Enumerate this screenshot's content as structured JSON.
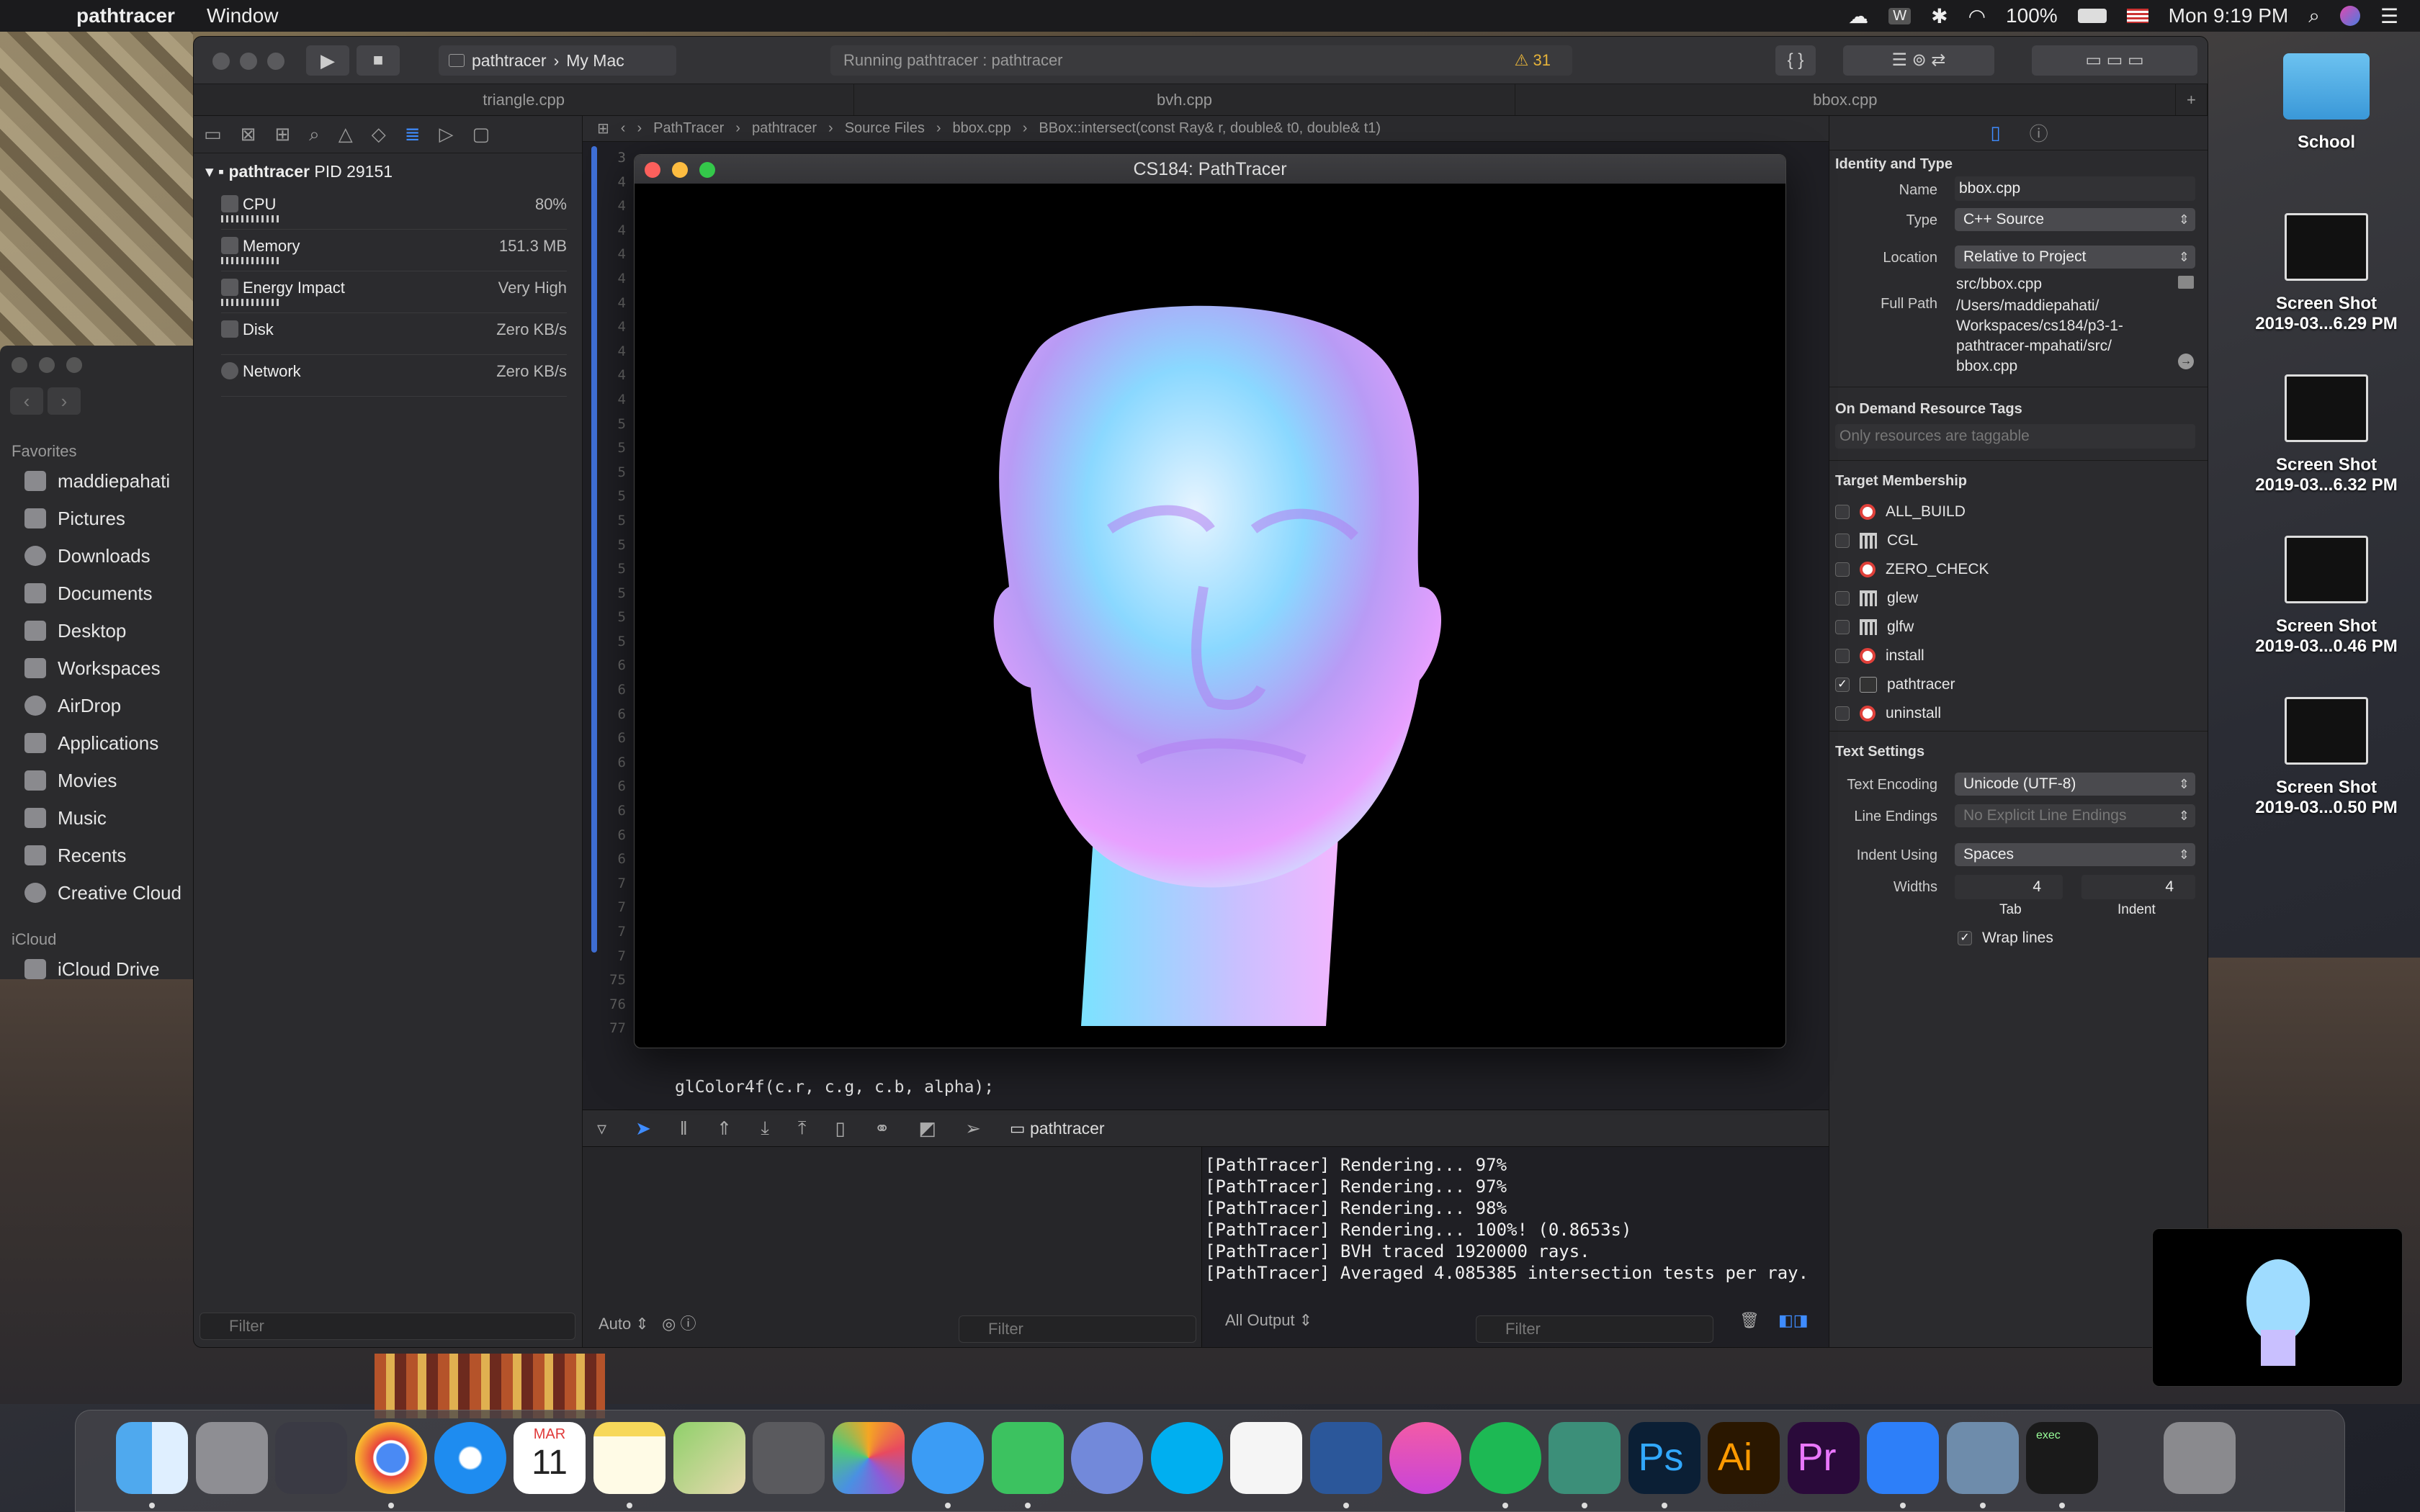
{
  "menubar": {
    "app": "pathtracer",
    "menu": "Window",
    "battery": "100%",
    "clock": "Mon 9:19 PM"
  },
  "finder": {
    "favorites_header": "Favorites",
    "items": [
      "maddiepahati",
      "Pictures",
      "Downloads",
      "Documents",
      "Desktop",
      "Workspaces",
      "AirDrop",
      "Applications",
      "Movies",
      "Music",
      "Recents",
      "Creative Cloud"
    ],
    "icloud_header": "iCloud",
    "icloud_item": "iCloud Drive"
  },
  "xcode": {
    "scheme": "pathtracer",
    "destination": "My Mac",
    "activity": "Running pathtracer : pathtracer",
    "warnings": "31",
    "tabs": [
      "triangle.cpp",
      "bvh.cpp",
      "bbox.cpp"
    ],
    "process": {
      "name": "pathtracer",
      "pid": "PID 29151"
    },
    "gauges": [
      {
        "label": "CPU",
        "value": "80%"
      },
      {
        "label": "Memory",
        "value": "151.3 MB"
      },
      {
        "label": "Energy Impact",
        "value": "Very High"
      },
      {
        "label": "Disk",
        "value": "Zero KB/s"
      },
      {
        "label": "Network",
        "value": "Zero KB/s"
      }
    ],
    "nav_filter": "Filter",
    "jumpbar": [
      "PathTracer",
      "pathtracer",
      "Source Files",
      "bbox.cpp",
      "BBox::intersect(const Ray& r, double& t0, double& t1)"
    ],
    "line_numbers": [
      "3",
      "4",
      "4",
      "4",
      "4",
      "4",
      "4",
      "4",
      "4",
      "4",
      "4",
      "5",
      "5",
      "5",
      "5",
      "5",
      "5",
      "5",
      "5",
      "5",
      "5",
      "6",
      "6",
      "6",
      "6",
      "6",
      "6",
      "6",
      "6",
      "6",
      "7",
      "7",
      "7",
      "7",
      "75",
      "76",
      "77"
    ],
    "code_line_76": "glColor4f(c.r, c.g, c.b, alpha);",
    "debug_target": "pathtracer",
    "console": [
      "[PathTracer] Rendering... 97%",
      "[PathTracer] Rendering... 97%",
      "[PathTracer] Rendering... 98%",
      "[PathTracer] Rendering... 100%! (0.8653s)",
      "[PathTracer] BVH traced 1920000 rays.",
      "[PathTracer] Averaged 4.085385 intersection tests per ray."
    ],
    "vars_mode": "Auto",
    "filter": "Filter",
    "output_mode": "All Output"
  },
  "inspector": {
    "identity_title": "Identity and Type",
    "name_label": "Name",
    "name_value": "bbox.cpp",
    "type_label": "Type",
    "type_value": "C++ Source",
    "location_label": "Location",
    "location_value": "Relative to Project",
    "relative_path": "src/bbox.cpp",
    "fullpath_label": "Full Path",
    "fullpath_lines": [
      "/Users/maddiepahati/",
      "Workspaces/cs184/p3-1-",
      "pathtracer-mpahati/src/",
      "bbox.cpp"
    ],
    "odr_title": "On Demand Resource Tags",
    "odr_placeholder": "Only resources are taggable",
    "target_title": "Target Membership",
    "targets": [
      {
        "name": "ALL_BUILD",
        "kind": "target",
        "checked": false
      },
      {
        "name": "CGL",
        "kind": "library",
        "checked": false
      },
      {
        "name": "ZERO_CHECK",
        "kind": "target",
        "checked": false
      },
      {
        "name": "glew",
        "kind": "library",
        "checked": false
      },
      {
        "name": "glfw",
        "kind": "library",
        "checked": false
      },
      {
        "name": "install",
        "kind": "target",
        "checked": false
      },
      {
        "name": "pathtracer",
        "kind": "app",
        "checked": true
      },
      {
        "name": "uninstall",
        "kind": "target",
        "checked": false
      }
    ],
    "text_title": "Text Settings",
    "encoding_label": "Text Encoding",
    "encoding_value": "Unicode (UTF-8)",
    "endings_label": "Line Endings",
    "endings_value": "No Explicit Line Endings",
    "indent_label": "Indent Using",
    "indent_value": "Spaces",
    "widths_label": "Widths",
    "tab_width": "4",
    "indent_width": "4",
    "tab_label": "Tab",
    "indent_sub_label": "Indent",
    "wrap_label": "Wrap lines"
  },
  "render_window": {
    "title": "CS184: PathTracer"
  },
  "desktop": {
    "folder": "School",
    "shots": [
      [
        "Screen Shot",
        "2019-03...6.29 PM"
      ],
      [
        "Screen Shot",
        "2019-03...6.32 PM"
      ],
      [
        "Screen Shot",
        "2019-03...0.46 PM"
      ],
      [
        "Screen Shot",
        "2019-03...0.50 PM"
      ]
    ]
  },
  "dock": {
    "calendar_month": "MAR",
    "calendar_day": "11",
    "apps": [
      "Finder",
      "System Preferences",
      "Launchpad",
      "Chrome",
      "Safari",
      "Calendar",
      "Notes",
      "Maps",
      "Calculator",
      "Photos",
      "Messages",
      "FaceTime",
      "Discord",
      "Skype",
      "Pages",
      "Word",
      "iTunes",
      "Spotify",
      "Atom",
      "Photoshop",
      "Illustrator",
      "Premiere",
      "Xcode",
      "Preview",
      "Terminal",
      "Trash"
    ],
    "ps": "Ps",
    "ai": "Ai",
    "pr": "Pr",
    "terminal": "exec"
  }
}
